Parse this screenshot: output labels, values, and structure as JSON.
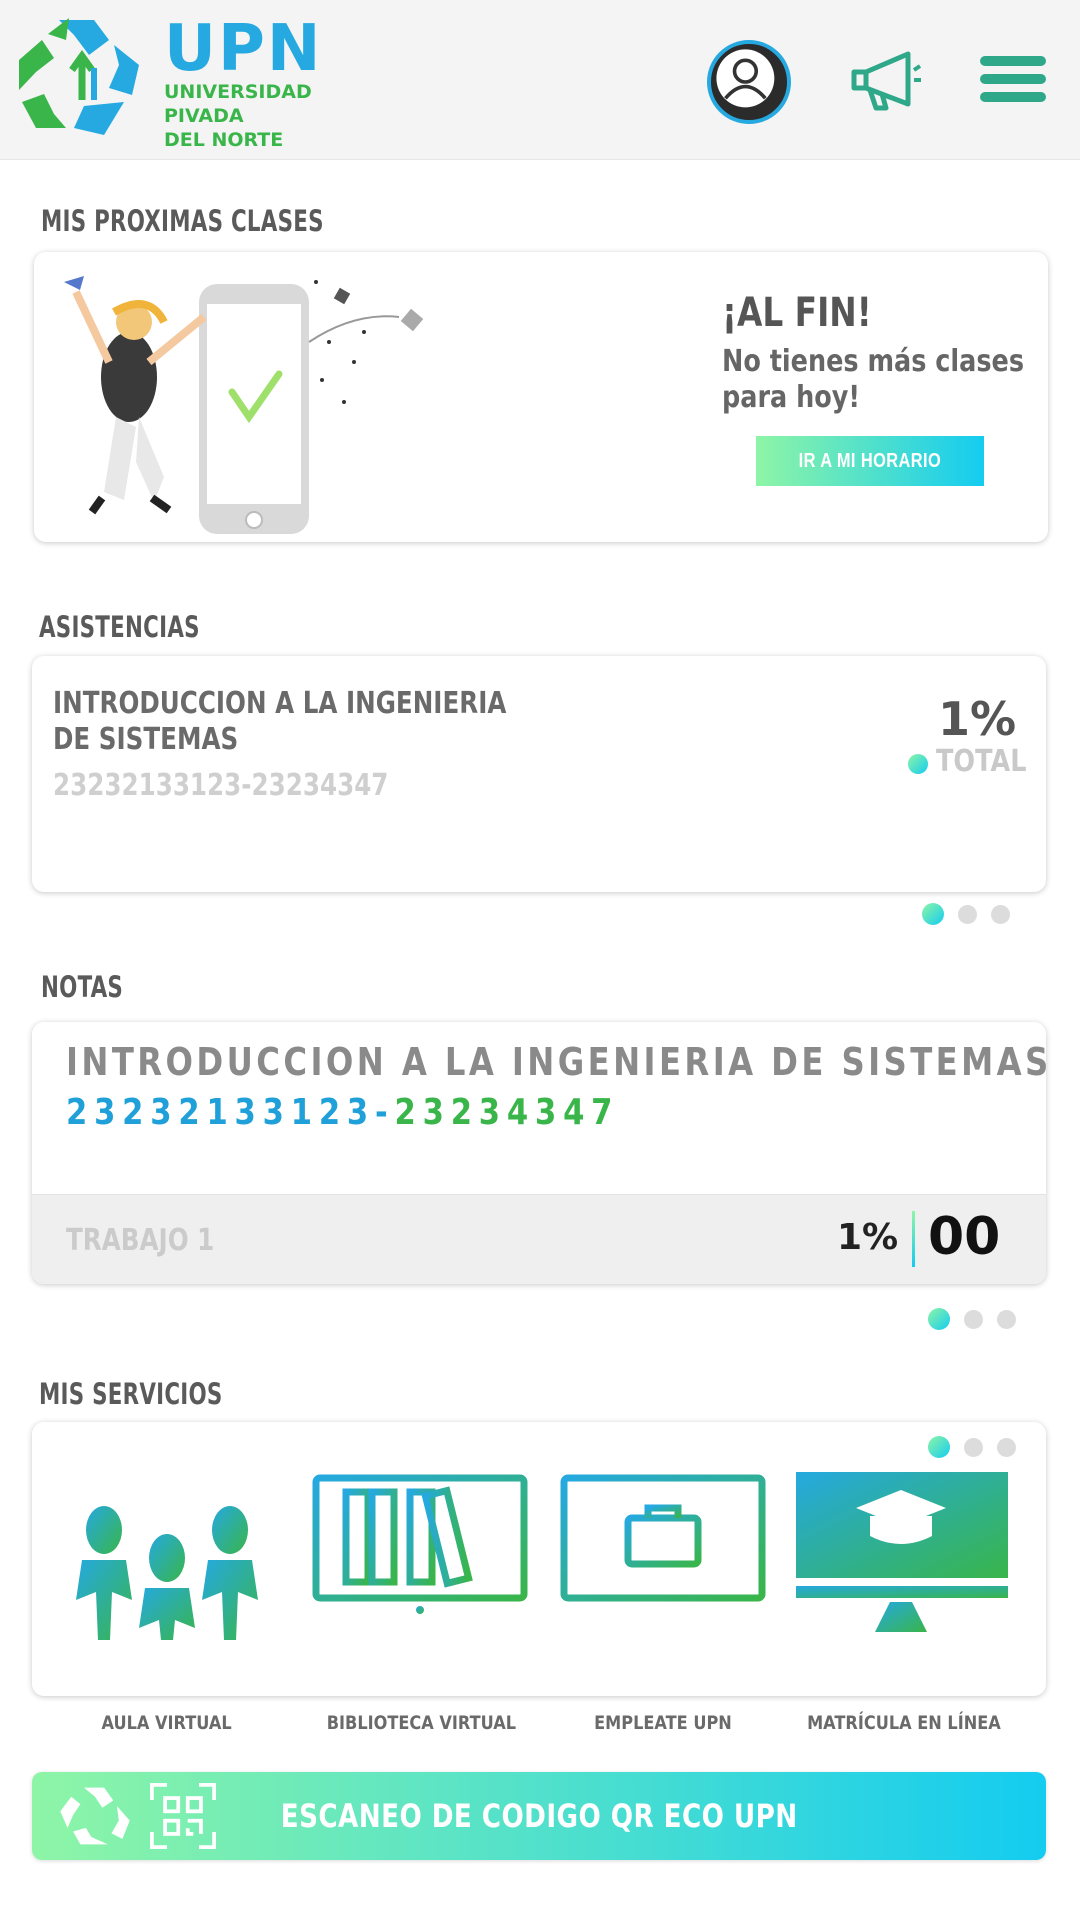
{
  "header": {
    "logo_title": "UPN",
    "logo_sub": [
      "UNIVERSIDAD",
      "PIVADA",
      "DEL NORTE"
    ],
    "icons": [
      "profile-icon",
      "megaphone-icon",
      "hamburger-menu-icon"
    ]
  },
  "clases": {
    "section_title": "MIS PROXIMAS CLASES",
    "heading": "¡AL FIN!",
    "message": "No tienes más clases para hoy!",
    "button_label": "IR A MI HORARIO"
  },
  "asistencias": {
    "section_title": "ASISTENCIAS",
    "course_line1": "INTRODUCCION A LA INGENIERIA",
    "course_line2": "DE SISTEMAS",
    "code": "23232133123-23234347",
    "percent": "1%",
    "total_label": "TOTAL",
    "page_count": 3,
    "active_page": 1
  },
  "notas": {
    "section_title": "NOTAS",
    "course": "INTRODUCCION A LA INGENIERIA DE SISTEMAS",
    "code_blue": "23232133123",
    "code_sep": "-",
    "code_green": "23234347",
    "item_label": "TRABAJO 1",
    "item_percent": "1%",
    "item_score": "00",
    "page_count": 3,
    "active_page": 1
  },
  "servicios": {
    "section_title": "MIS SERVICIOS",
    "items": [
      {
        "label": "AULA VIRTUAL",
        "icon": "people-icon"
      },
      {
        "label": "BIBLIOTECA VIRTUAL",
        "icon": "library-monitor-icon"
      },
      {
        "label": "EMPLEATE UPN",
        "icon": "briefcase-monitor-icon"
      },
      {
        "label": "MATRÍCULA EN LÍNEA",
        "icon": "graduation-monitor-icon"
      }
    ],
    "page_count": 3,
    "active_page": 1
  },
  "qr": {
    "label": "ESCANEO DE CODIGO QR ECO UPN",
    "icons": [
      "recycle-icon",
      "qr-scan-icon"
    ]
  },
  "colors": {
    "gradient_start": "#8ef5a6",
    "gradient_end": "#14ccf0",
    "brand_blue": "#25a9e0",
    "brand_green": "#39b54a",
    "menu_teal": "#2fa88a"
  }
}
